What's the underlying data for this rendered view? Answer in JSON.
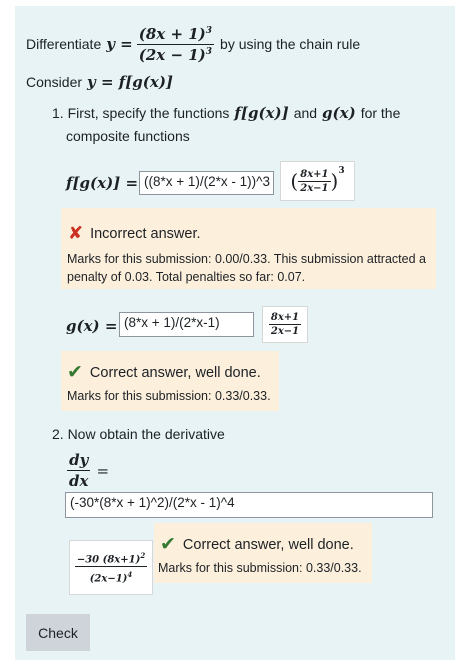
{
  "question": {
    "intro": "Differentiate",
    "y_eq": "y =",
    "numerator": "(8x + 1)",
    "numerator_power": "3",
    "denominator": "(2x − 1)",
    "denominator_power": "3",
    "suffix": "by using the chain rule",
    "consider_label": "Consider",
    "consider_math": "y = f[g(x)]"
  },
  "part1": {
    "instruction_start": "1. First, specify the functions",
    "instruction_f": "f[g(x)]",
    "instruction_and": "and",
    "instruction_g": "g(x)",
    "instruction_for": "for the",
    "instruction_line2": "composite functions",
    "f_label": "f[g(x)] =",
    "f_input_value": "((8*x + 1)/(2*x - 1))^3",
    "f_preview_num": "8x+1",
    "f_preview_den": "2x−1",
    "f_preview_power": "3",
    "f_feedback_title": "Incorrect answer.",
    "f_feedback_marks": "Marks for this submission: 0.00/0.33. This submission attracted a penalty of 0.03. Total penalties so far: 0.07.",
    "g_label": "g(x) =",
    "g_input_value": "(8*x + 1)/(2*x-1)",
    "g_preview_num": "8x+1",
    "g_preview_den": "2x−1",
    "g_feedback_title": "Correct answer, well done.",
    "g_feedback_marks": "Marks for this submission: 0.33/0.33."
  },
  "part2": {
    "instruction": "2. Now obtain the derivative",
    "dy": "dy",
    "dx": "dx",
    "eq": "=",
    "input_value": "(-30*(8*x + 1)^2)/(2*x - 1)^4",
    "preview_num": "−30 (8x+1)",
    "preview_num_power": "2",
    "preview_den": "(2x−1)",
    "preview_den_power": "4",
    "feedback_title": "Correct answer, well done.",
    "feedback_marks": "Marks for this submission: 0.33/0.33."
  },
  "check_button": "Check",
  "icons": {
    "incorrect": "cross-icon",
    "correct": "check-icon"
  },
  "colors": {
    "panel": "#e7f3f5",
    "feedback": "#fcefdc",
    "incorrect": "#ca3120",
    "correct": "#357a32",
    "button": "#ced4da"
  }
}
